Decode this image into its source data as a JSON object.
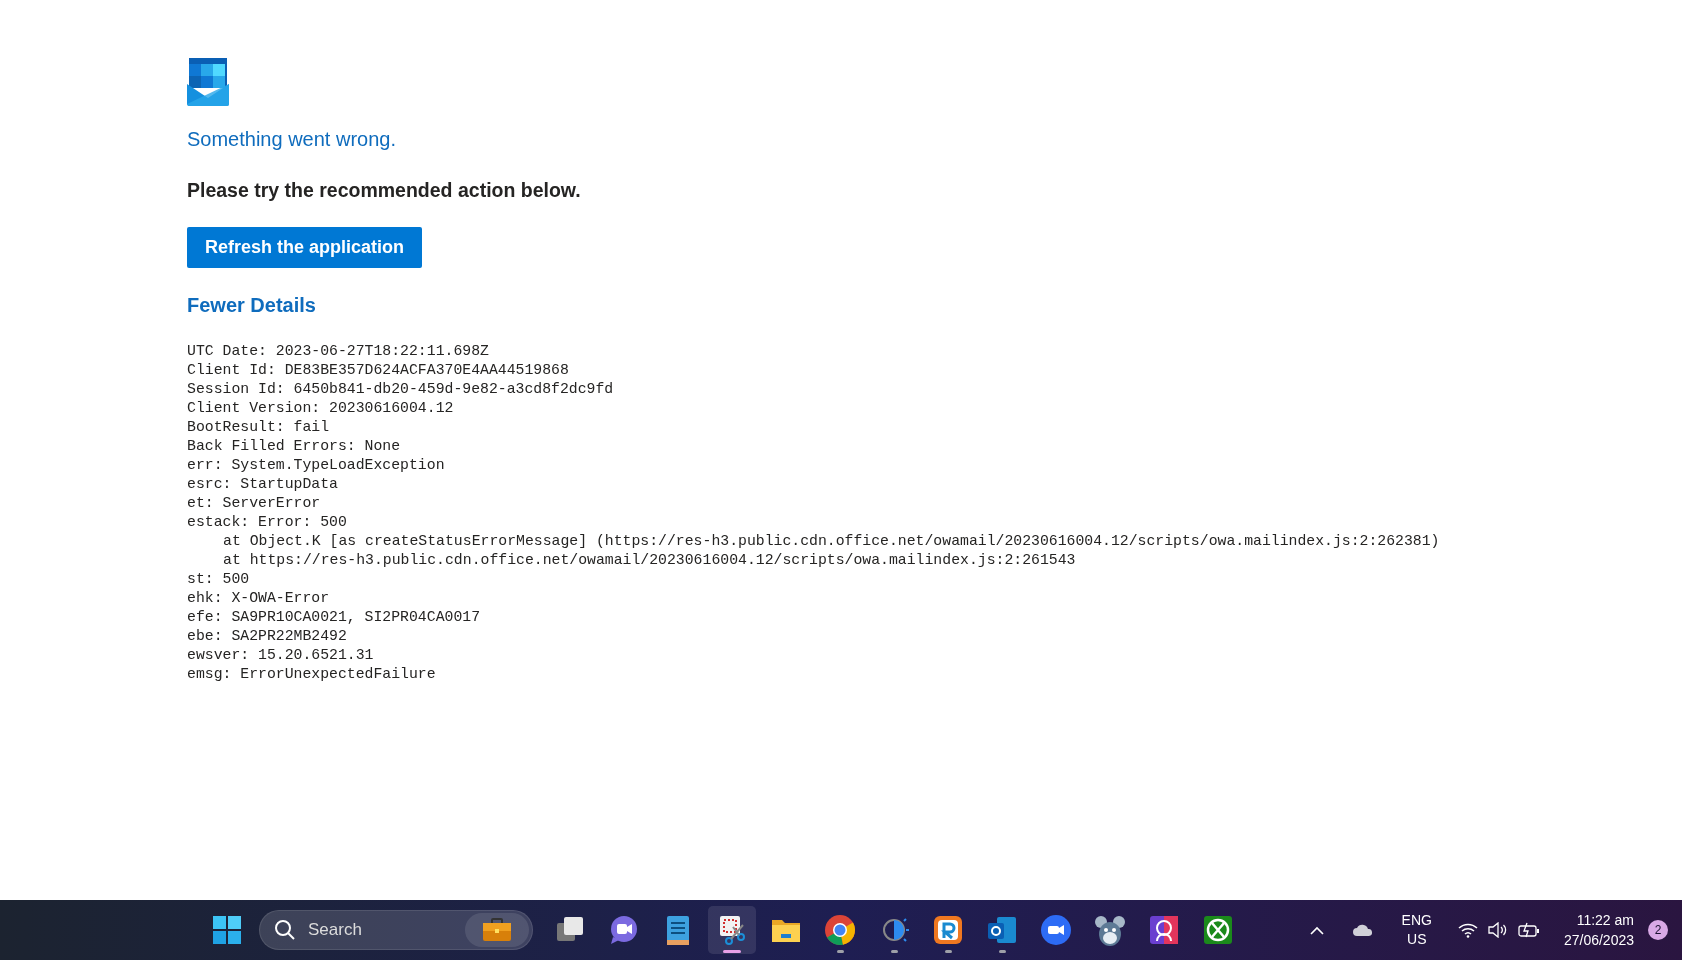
{
  "header": {
    "title": "Something went wrong.",
    "message": "Please try the recommended action below.",
    "action_button": "Refresh the application",
    "details_toggle": "Fewer Details"
  },
  "details": [
    {
      "text": "UTC Date: 2023-06-27T18:22:11.698Z",
      "indented": false
    },
    {
      "text": "Client Id: DE83BE357D624ACFA370E4AA44519868",
      "indented": false
    },
    {
      "text": "Session Id: 6450b841-db20-459d-9e82-a3cd8f2dc9fd",
      "indented": false
    },
    {
      "text": "Client Version: 20230616004.12",
      "indented": false
    },
    {
      "text": "BootResult: fail",
      "indented": false
    },
    {
      "text": "Back Filled Errors: None",
      "indented": false
    },
    {
      "text": "err: System.TypeLoadException",
      "indented": false
    },
    {
      "text": "esrc: StartupData",
      "indented": false
    },
    {
      "text": "et: ServerError",
      "indented": false
    },
    {
      "text": "estack: Error: 500",
      "indented": false
    },
    {
      "text": "at Object.K [as createStatusErrorMessage] (https://res-h3.public.cdn.office.net/owamail/20230616004.12/scripts/owa.mailindex.js:2:262381)",
      "indented": true
    },
    {
      "text": "at https://res-h3.public.cdn.office.net/owamail/20230616004.12/scripts/owa.mailindex.js:2:261543",
      "indented": true
    },
    {
      "text": "st: 500",
      "indented": false
    },
    {
      "text": "ehk: X-OWA-Error",
      "indented": false
    },
    {
      "text": "efe: SA9PR10CA0021, SI2PR04CA0017",
      "indented": false
    },
    {
      "text": "ebe: SA2PR22MB2492",
      "indented": false
    },
    {
      "text": "ewsver: 15.20.6521.31",
      "indented": false
    },
    {
      "text": "emsg: ErrorUnexpectedFailure",
      "indented": false
    }
  ],
  "taskbar": {
    "search": {
      "placeholder": "Search"
    },
    "apps": [
      {
        "kind": "windows",
        "running": false,
        "active": false
      },
      {
        "kind": "taskview",
        "running": false,
        "active": false
      },
      {
        "kind": "meet",
        "running": false,
        "active": false
      },
      {
        "kind": "notepad",
        "running": false,
        "active": false
      },
      {
        "kind": "snip",
        "running": true,
        "active": true
      },
      {
        "kind": "folder",
        "running": false,
        "active": false
      },
      {
        "kind": "chrome",
        "running": true,
        "active": false
      },
      {
        "kind": "theme",
        "running": true,
        "active": false
      },
      {
        "kind": "rapp",
        "running": true,
        "active": false
      },
      {
        "kind": "outlook",
        "running": true,
        "active": false
      },
      {
        "kind": "video",
        "running": false,
        "active": false
      },
      {
        "kind": "mascot",
        "running": false,
        "active": false
      },
      {
        "kind": "photo",
        "running": false,
        "active": false
      },
      {
        "kind": "xbox",
        "running": false,
        "active": false
      }
    ],
    "tray": {
      "language": "ENG",
      "region": "US",
      "time": "11:22 am",
      "date": "27/06/2023",
      "notification_count": "2"
    }
  }
}
